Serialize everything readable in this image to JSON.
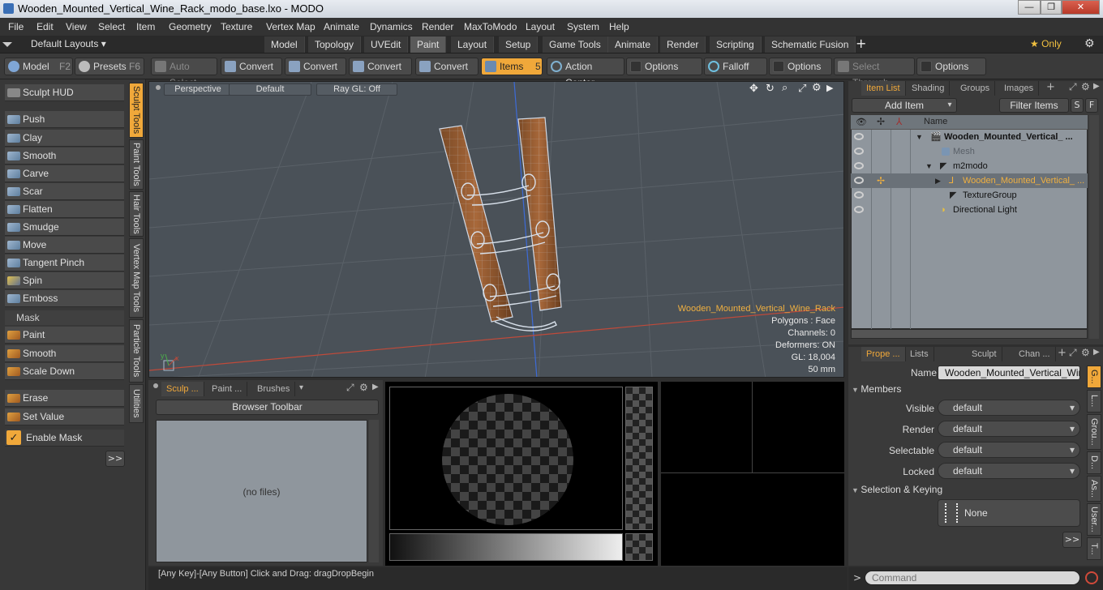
{
  "window": {
    "title": "Wooden_Mounted_Vertical_Wine_Rack_modo_base.lxo - MODO",
    "min_label": "—",
    "max_label": "❐",
    "close_label": "✕"
  },
  "menu": [
    "File",
    "Edit",
    "View",
    "Select",
    "Item",
    "Geometry",
    "Texture",
    "Vertex Map",
    "Animate",
    "Dynamics",
    "Render",
    "MaxToModo",
    "Layout",
    "System",
    "Help"
  ],
  "layouts": {
    "dropdown": "Default Layouts ▾",
    "tabs": [
      "Model",
      "Topology",
      "UVEdit",
      "Paint",
      "Layout",
      "Setup",
      "Game Tools",
      "Animate",
      "Render",
      "Scripting",
      "Schematic Fusion"
    ],
    "active_tab": "Paint",
    "add": "+",
    "only": "★ Only"
  },
  "toolbar": {
    "model": "Model",
    "model_key": "F2",
    "presets": "Presets",
    "presets_key": "F6",
    "auto_select": "Auto Select",
    "convert1": "Convert",
    "convert2": "Convert",
    "convert3": "Convert",
    "convert4": "Convert",
    "items": "Items",
    "items_key": "5",
    "action_center": "Action Center",
    "options1": "Options",
    "falloff": "Falloff",
    "options2": "Options",
    "select_through": "Select Through",
    "options3": "Options"
  },
  "left": {
    "sculpt_hud": "Sculpt HUD",
    "tools": [
      "Push",
      "Clay",
      "Smooth",
      "Carve",
      "Scar",
      "Flatten",
      "Smudge",
      "Move",
      "Tangent Pinch",
      "Spin",
      "Emboss"
    ],
    "mask_header": "Mask",
    "mask_tools": [
      "Paint",
      "Smooth",
      "Scale Down"
    ],
    "erase": "Erase",
    "set_value": "Set Value",
    "enable_mask": "Enable Mask",
    "more": ">>"
  },
  "vtabs": [
    "Sculpt Tools",
    "Paint Tools",
    "Hair Tools",
    "Vertex Map Tools",
    "Particle Tools",
    "Utilities"
  ],
  "viewport": {
    "perspective": "Perspective",
    "default": "Default",
    "raygl": "Ray GL: Off",
    "item_name": "Wooden_Mounted_Vertical_Wine_Rack",
    "polygons": "Polygons : Face",
    "channels": "Channels: 0",
    "deformers": "Deformers: ON",
    "gl": "GL: 18,004",
    "scale": "50 mm"
  },
  "itemlist": {
    "tabs": [
      "Item List",
      "Shading",
      "Groups",
      "Images"
    ],
    "add_item": "Add Item",
    "filter_items": "Filter Items",
    "s": "S",
    "f": "F",
    "col_name": "Name",
    "rows": [
      {
        "label": "Wooden_Mounted_Vertical_ ...",
        "indent": 40,
        "bold": true
      },
      {
        "label": "Mesh",
        "indent": 62,
        "dim": true
      },
      {
        "label": "m2modo",
        "indent": 62
      },
      {
        "label": "Wooden_Mounted_Vertical_ ...",
        "indent": 84,
        "selected": true
      },
      {
        "label": "TextureGroup",
        "indent": 74
      },
      {
        "label": "Directional Light",
        "indent": 62
      }
    ]
  },
  "brushes": {
    "tabs": [
      "Sculp ...",
      "Paint ...",
      "Brushes"
    ],
    "browser_toolbar": "Browser Toolbar",
    "no_files": "(no files)"
  },
  "props": {
    "tabs": [
      "Prope ...",
      "Lists",
      "Sculpt",
      "Chan ..."
    ],
    "name_label": "Name",
    "name_value": "Wooden_Mounted_Vertical_Wine_",
    "members": "Members",
    "visible_label": "Visible",
    "visible_value": "default",
    "render_label": "Render",
    "render_value": "default",
    "selectable_label": "Selectable",
    "selectable_value": "default",
    "locked_label": "Locked",
    "locked_value": "default",
    "sel_keying": "Selection & Keying",
    "none": "None",
    "more": ">>",
    "side_tabs": [
      "G...",
      "L...",
      "Grou...",
      "D...",
      "As...",
      "User...",
      "T..."
    ]
  },
  "status": {
    "text": "[Any Key]-[Any Button] Click and Drag:  dragDropBegin",
    "command_placeholder": "Command",
    "prompt": ">"
  }
}
